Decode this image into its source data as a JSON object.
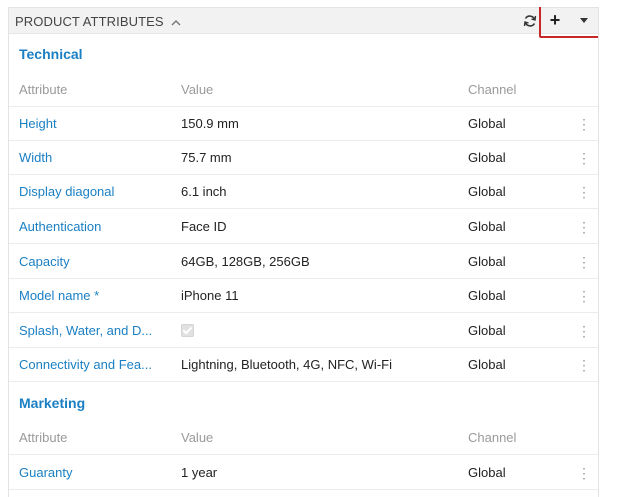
{
  "panel": {
    "title": "PRODUCT ATTRIBUTES",
    "collapse_icon": "chevron-up-icon",
    "refresh_icon": "refresh-icon",
    "add_label": "+",
    "dropdown_icon": "caret-down-icon"
  },
  "columns": {
    "attribute": "Attribute",
    "value": "Value",
    "channel": "Channel"
  },
  "sections": [
    {
      "title": "Technical",
      "rows": [
        {
          "attribute": "Height",
          "value": "150.9 mm",
          "channel": "Global"
        },
        {
          "attribute": "Width",
          "value": "75.7 mm",
          "channel": "Global"
        },
        {
          "attribute": "Display diagonal",
          "value": "6.1 inch",
          "channel": "Global"
        },
        {
          "attribute": "Authentication",
          "value": "Face ID",
          "channel": "Global"
        },
        {
          "attribute": "Capacity",
          "value": "64GB, 128GB, 256GB",
          "channel": "Global"
        },
        {
          "attribute": "Model name *",
          "value": "iPhone 11",
          "channel": "Global"
        },
        {
          "attribute": "Splash, Water, and D...",
          "value": "",
          "value_checked": true,
          "channel": "Global"
        },
        {
          "attribute": "Connectivity and Fea...",
          "value": "Lightning, Bluetooth, 4G, NFC, Wi-Fi",
          "channel": "Global"
        }
      ]
    },
    {
      "title": "Marketing",
      "rows": [
        {
          "attribute": "Guaranty",
          "value": "1 year",
          "channel": "Global"
        }
      ]
    }
  ],
  "colors": {
    "link": "#1a7fc3",
    "highlight_border": "#c62828"
  }
}
